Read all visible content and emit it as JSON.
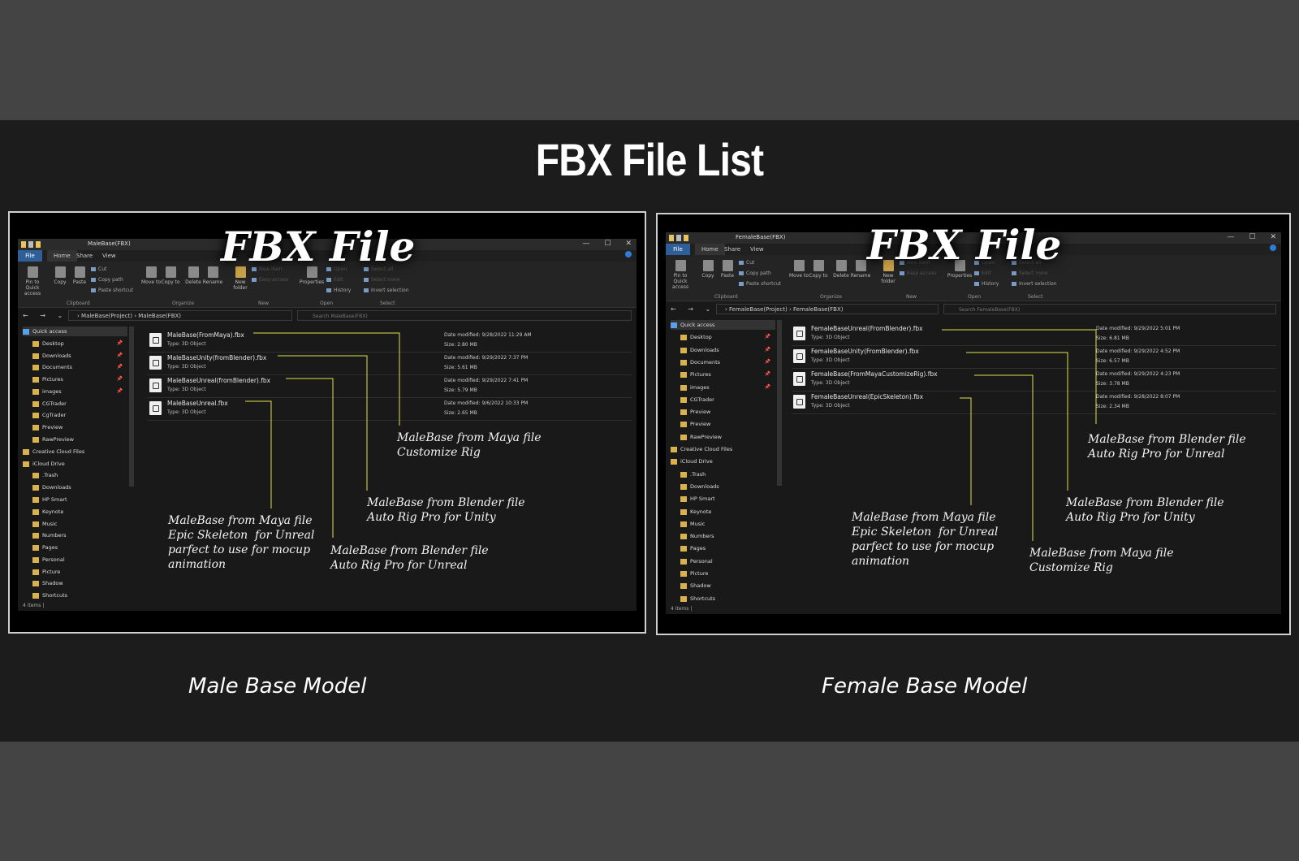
{
  "page": {
    "title": "FBX File List"
  },
  "colors": {
    "leader": "#e3e34a",
    "file_tab": "#2e5f99",
    "folder": "#d8b24e"
  },
  "panels": [
    {
      "overlay_title": "FBX File",
      "caption": "Male Base Model",
      "window": {
        "title": "MaleBase(FBX)",
        "controls": [
          "—",
          "☐",
          "✕"
        ],
        "tabs": [
          "File",
          "Home",
          "Share",
          "View"
        ],
        "ribbon": {
          "pin": "Pin to Quick access",
          "copy": "Copy",
          "paste": "Paste",
          "cut": "Cut",
          "copy_path": "Copy path",
          "paste_shortcut": "Paste shortcut",
          "move_to": "Move to",
          "copy_to": "Copy to",
          "delete": "Delete",
          "rename": "Rename",
          "new_folder": "New folder",
          "new_item": "New item",
          "easy_access": "Easy access",
          "properties": "Properties",
          "open": "Open",
          "edit": "Edit",
          "history": "History",
          "select_all": "Select all",
          "select_none": "Select none",
          "invert_selection": "Invert selection",
          "groups": [
            "Clipboard",
            "Organize",
            "New",
            "Open",
            "Select"
          ]
        },
        "address": {
          "path": "›  MaleBase(Project)  ›  MaleBase(FBX)",
          "search_placeholder": "Search MaleBase(FBX)"
        },
        "nav_items": [
          {
            "label": "Quick access",
            "pin": ""
          },
          {
            "label": "Desktop",
            "pin": "📌"
          },
          {
            "label": "Downloads",
            "pin": "📌"
          },
          {
            "label": "Documents",
            "pin": "📌"
          },
          {
            "label": "Pictures",
            "pin": "📌"
          },
          {
            "label": "images",
            "pin": "📌"
          },
          {
            "label": "CGTrader",
            "pin": ""
          },
          {
            "label": "CgTrader",
            "pin": ""
          },
          {
            "label": "Preview",
            "pin": ""
          },
          {
            "label": "RawPreview",
            "pin": ""
          },
          {
            "label": "Creative Cloud Files",
            "pin": ""
          },
          {
            "label": "iCloud Drive",
            "pin": ""
          },
          {
            "label": ".Trash",
            "pin": ""
          },
          {
            "label": "Downloads",
            "pin": ""
          },
          {
            "label": "HP Smart",
            "pin": ""
          },
          {
            "label": "Keynote",
            "pin": ""
          },
          {
            "label": "Music",
            "pin": ""
          },
          {
            "label": "Numbers",
            "pin": ""
          },
          {
            "label": "Pages",
            "pin": ""
          },
          {
            "label": "Personal",
            "pin": ""
          },
          {
            "label": "Picture",
            "pin": ""
          },
          {
            "label": "Shadow",
            "pin": ""
          },
          {
            "label": "Shortcuts",
            "pin": ""
          }
        ],
        "files": [
          {
            "name": "MaleBase(FromMaya).fbx",
            "type": "Type: 3D Object",
            "date": "Date modified: 9/28/2022 11:29 AM",
            "size": "Size: 2.80 MB"
          },
          {
            "name": "MaleBaseUnity(fromBlender).fbx",
            "type": "Type: 3D Object",
            "date": "Date modified: 9/29/2022 7:37 PM",
            "size": "Size: 5.61 MB"
          },
          {
            "name": "MaleBaseUnreal(fromBlender).fbx",
            "type": "Type: 3D Object",
            "date": "Date modified: 9/29/2022 7:41 PM",
            "size": "Size: 5.79 MB"
          },
          {
            "name": "MaleBaseUnreal.fbx",
            "type": "Type: 3D Object",
            "date": "Date modified: 9/6/2022 10:33 PM",
            "size": "Size: 2.65 MB"
          }
        ],
        "status": "4 items  |"
      },
      "annotations": [
        "MaleBase from Maya file\nCustomize Rig",
        "MaleBase from Blender file\nAuto Rig Pro for Unity",
        "MaleBase from Maya file\nEpic Skeleton  for Unreal\nparfect to use for mocup\nanimation",
        "MaleBase from Blender file\nAuto Rig Pro for Unreal"
      ]
    },
    {
      "overlay_title": "FBX File",
      "caption": "Female Base Model",
      "window": {
        "title": "FemaleBase(FBX)",
        "controls": [
          "—",
          "☐",
          "✕"
        ],
        "tabs": [
          "File",
          "Home",
          "Share",
          "View"
        ],
        "ribbon": {
          "pin": "Pin to Quick access",
          "copy": "Copy",
          "paste": "Paste",
          "cut": "Cut",
          "copy_path": "Copy path",
          "paste_shortcut": "Paste shortcut",
          "move_to": "Move to",
          "copy_to": "Copy to",
          "delete": "Delete",
          "rename": "Rename",
          "new_folder": "New folder",
          "new_item": "New item",
          "easy_access": "Easy access",
          "properties": "Properties",
          "open": "Open",
          "edit": "Edit",
          "history": "History",
          "select_all": "Select all",
          "select_none": "Select none",
          "invert_selection": "Invert selection",
          "groups": [
            "Clipboard",
            "Organize",
            "New",
            "Open",
            "Select"
          ]
        },
        "address": {
          "path": "›  FemaleBase(Project)  ›  FemaleBase(FBX)",
          "search_placeholder": "Search FemaleBase(FBX)"
        },
        "nav_items": [
          {
            "label": "Quick access",
            "pin": ""
          },
          {
            "label": "Desktop",
            "pin": "📌"
          },
          {
            "label": "Downloads",
            "pin": "📌"
          },
          {
            "label": "Documents",
            "pin": "📌"
          },
          {
            "label": "Pictures",
            "pin": "📌"
          },
          {
            "label": "images",
            "pin": "📌"
          },
          {
            "label": "CGTrader",
            "pin": ""
          },
          {
            "label": "Preview",
            "pin": ""
          },
          {
            "label": "Preview",
            "pin": ""
          },
          {
            "label": "RawPreview",
            "pin": ""
          },
          {
            "label": "Creative Cloud Files",
            "pin": ""
          },
          {
            "label": "iCloud Drive",
            "pin": ""
          },
          {
            "label": ".Trash",
            "pin": ""
          },
          {
            "label": "Downloads",
            "pin": ""
          },
          {
            "label": "HP Smart",
            "pin": ""
          },
          {
            "label": "Keynote",
            "pin": ""
          },
          {
            "label": "Music",
            "pin": ""
          },
          {
            "label": "Numbers",
            "pin": ""
          },
          {
            "label": "Pages",
            "pin": ""
          },
          {
            "label": "Personal",
            "pin": ""
          },
          {
            "label": "Picture",
            "pin": ""
          },
          {
            "label": "Shadow",
            "pin": ""
          },
          {
            "label": "Shortcuts",
            "pin": ""
          }
        ],
        "files": [
          {
            "name": "FemaleBaseUnreal(FromBlender).fbx",
            "type": "Type: 3D Object",
            "date": "Date modified: 9/29/2022 5:01 PM",
            "size": "Size: 6.81 MB"
          },
          {
            "name": "FemaleBaseUnity(FromBlender).fbx",
            "type": "Type: 3D Object",
            "date": "Date modified: 9/29/2022 4:52 PM",
            "size": "Size: 6.57 MB"
          },
          {
            "name": "FemaleBase(FromMayaCustomizeRig).fbx",
            "type": "Type: 3D Object",
            "date": "Date modified: 9/29/2022 4:23 PM",
            "size": "Size: 3.78 MB"
          },
          {
            "name": "FemaleBaseUnreal(EpicSkeleton).fbx",
            "type": "Type: 3D Object",
            "date": "Date modified: 9/28/2022 8:07 PM",
            "size": "Size: 2.34 MB"
          }
        ],
        "status": "4 items  |"
      },
      "annotations": [
        "MaleBase from Blender file\nAuto Rig Pro for Unreal",
        "MaleBase from Blender file\nAuto Rig Pro for Unity",
        "MaleBase from Maya file\nEpic Skeleton  for Unreal\nparfect to use for mocup\nanimation",
        "MaleBase from Maya file\nCustomize Rig"
      ]
    }
  ]
}
